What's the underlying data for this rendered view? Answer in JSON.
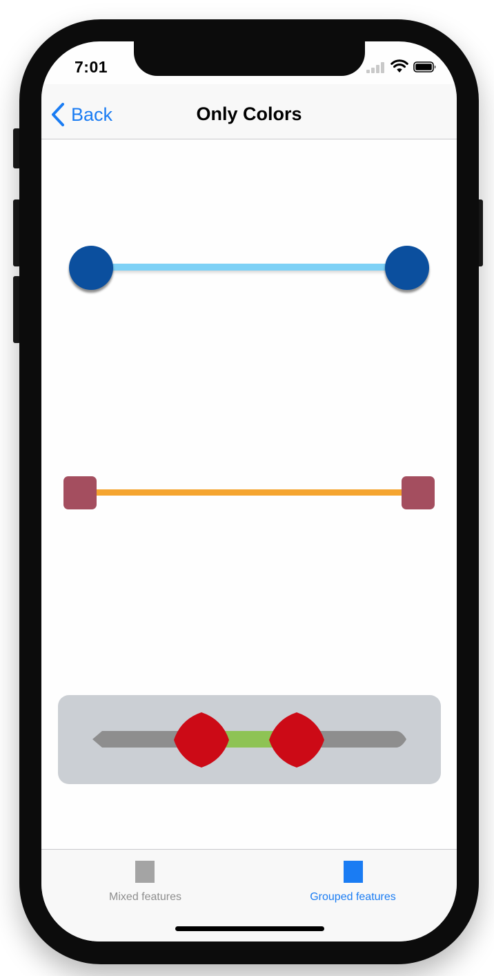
{
  "status_bar": {
    "time": "7:01",
    "signal_icon": "cellular-signal-icon",
    "signal_bars_active": 2,
    "wifi_icon": "wifi-icon",
    "battery_icon": "battery-icon"
  },
  "nav": {
    "back_label": "Back",
    "back_icon": "chevron-left-icon",
    "title": "Only Colors"
  },
  "sliders": [
    {
      "id": "circle-thumb-slider",
      "low": 0,
      "high": 1,
      "thumb_color": "#0b4f9e",
      "track_color": "#7ed1f6"
    },
    {
      "id": "square-thumb-slider",
      "low": 0,
      "high": 1,
      "thumb_color": "#a44e5f",
      "track_color": "#f5a530"
    },
    {
      "id": "custom-shape-slider",
      "low": 0.34,
      "high": 0.66,
      "thumb_color": "#cc0a16",
      "active_track_color": "#8ec354",
      "inactive_track_color": "#8e8e8e",
      "panel_color": "#cbcfd4"
    }
  ],
  "tab_bar": {
    "items": [
      {
        "label": "Mixed features",
        "icon": "square-icon",
        "selected": false,
        "color": "#9e9e9e"
      },
      {
        "label": "Grouped features",
        "icon": "square-icon",
        "selected": true,
        "color": "#1a7cf3"
      }
    ]
  },
  "colors": {
    "accent": "#1a7cf3"
  }
}
